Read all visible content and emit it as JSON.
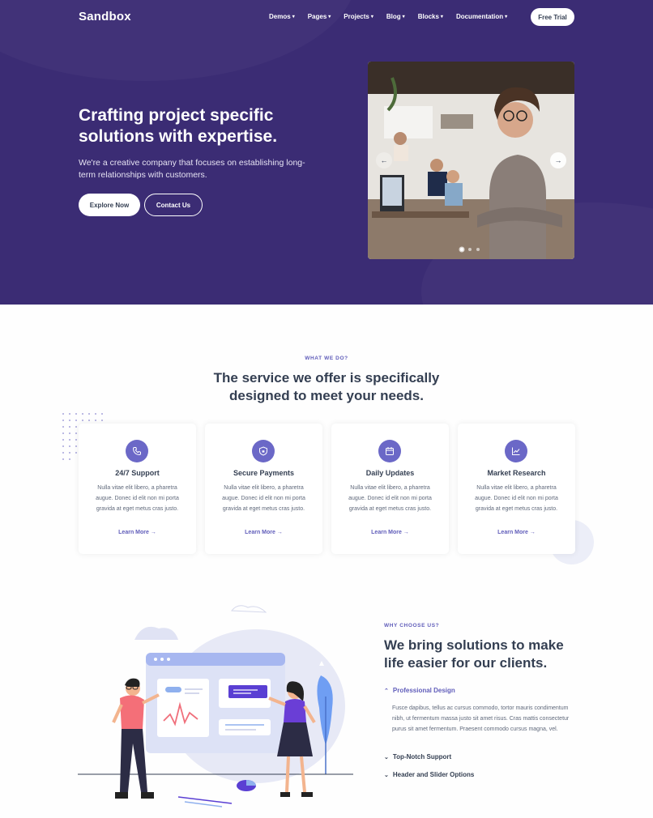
{
  "brand": {
    "logo": "Sandbox",
    "accent": "#605dba",
    "hero_bg": "#3b2c74"
  },
  "nav": {
    "items": [
      {
        "label": "Demos"
      },
      {
        "label": "Pages"
      },
      {
        "label": "Projects"
      },
      {
        "label": "Blog"
      },
      {
        "label": "Blocks"
      },
      {
        "label": "Documentation"
      }
    ],
    "cta": "Free Trial",
    "chevron": "chevron-down-icon"
  },
  "hero": {
    "title": "Crafting project specific solutions with expertise.",
    "subtitle": "We're a creative company that focuses on establishing long-term relationships with customers.",
    "primary_button": "Explore Now",
    "secondary_button": "Contact Us",
    "carousel": {
      "slides": 3,
      "active": 0
    }
  },
  "services": {
    "eyebrow": "WHAT WE DO?",
    "title_line1": "The service we offer is specifically",
    "title_line2": "designed to meet your needs.",
    "cards": [
      {
        "icon": "phone-icon",
        "title": "24/7 Support",
        "text": "Nulla vitae elit libero, a pharetra augue. Donec id elit non mi porta gravida at eget metus cras justo.",
        "link": "Learn More →"
      },
      {
        "icon": "shield-icon",
        "title": "Secure Payments",
        "text": "Nulla vitae elit libero, a pharetra augue. Donec id elit non mi porta gravida at eget metus cras justo.",
        "link": "Learn More →"
      },
      {
        "icon": "calendar-icon",
        "title": "Daily Updates",
        "text": "Nulla vitae elit libero, a pharetra augue. Donec id elit non mi porta gravida at eget metus cras justo.",
        "link": "Learn More →"
      },
      {
        "icon": "chart-icon",
        "title": "Market Research",
        "text": "Nulla vitae elit libero, a pharetra augue. Donec id elit non mi porta gravida at eget metus cras justo.",
        "link": "Learn More →"
      }
    ]
  },
  "why": {
    "eyebrow": "WHY CHOOSE US?",
    "title": "We bring solutions to make life easier for our clients.",
    "accordion": [
      {
        "label": "Professional Design",
        "open": true,
        "body": "Fusce dapibus, tellus ac cursus commodo, tortor mauris condimentum nibh, ut fermentum massa justo sit amet risus. Cras mattis consectetur purus sit amet fermentum. Praesent commodo cursus magna, vel."
      },
      {
        "label": "Top-Notch Support",
        "open": false
      },
      {
        "label": "Header and Slider Options",
        "open": false
      }
    ]
  }
}
